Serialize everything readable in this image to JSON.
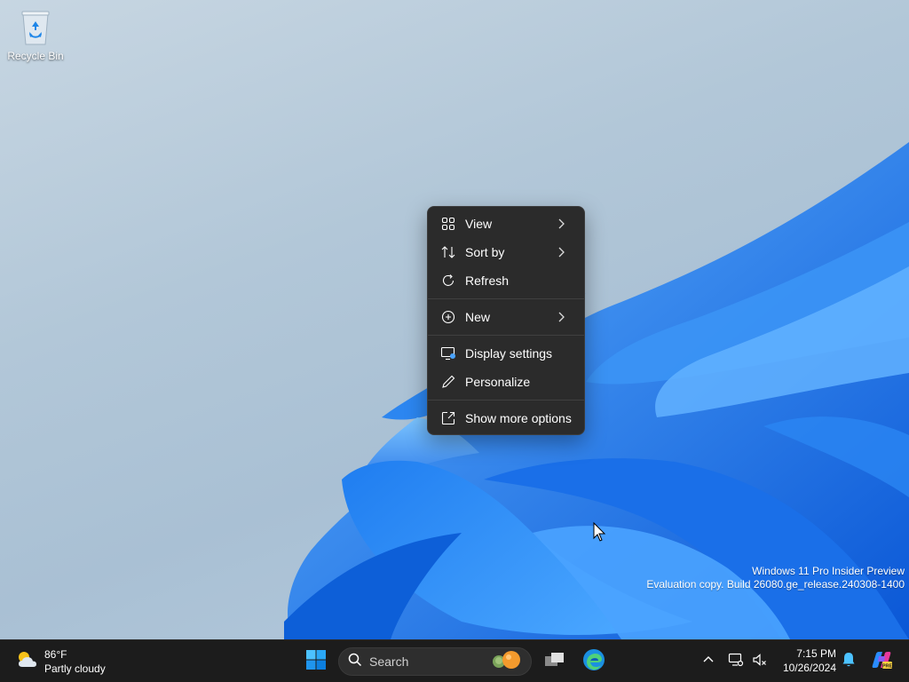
{
  "desktop": {
    "icons": [
      {
        "label": "Recycle Bin",
        "icon": "recycle-bin-icon"
      }
    ],
    "watermark": {
      "line1": "Windows 11 Pro Insider Preview",
      "line2": "Evaluation copy. Build 26080.ge_release.240308-1400"
    }
  },
  "context_menu": {
    "items": [
      {
        "label": "View",
        "icon": "grid-icon",
        "submenu": true
      },
      {
        "label": "Sort by",
        "icon": "sort-icon",
        "submenu": true
      },
      {
        "label": "Refresh",
        "icon": "refresh-icon",
        "submenu": false
      },
      {
        "label": "New",
        "icon": "plus-circle-icon",
        "submenu": true
      },
      {
        "label": "Display settings",
        "icon": "display-settings-icon",
        "submenu": false
      },
      {
        "label": "Personalize",
        "icon": "pen-icon",
        "submenu": false
      },
      {
        "label": "Show more options",
        "icon": "open-external-icon",
        "submenu": false
      }
    ]
  },
  "taskbar": {
    "weather": {
      "temp": "86°F",
      "condition": "Partly cloudy",
      "icon": "partly-cloudy-icon"
    },
    "search": {
      "placeholder": "Search"
    },
    "apps": [
      "windows-start-icon",
      "task-view-icon",
      "edge-icon"
    ],
    "tray": [
      "chevron-up-icon",
      "network-icon",
      "volume-muted-icon",
      "notification-bell-icon",
      "copilot-icon"
    ],
    "clock": {
      "time": "7:15 PM",
      "date": "10/26/2024"
    }
  },
  "colors": {
    "accent": "#0078d4",
    "menu_bg": "#2b2b2b",
    "taskbar_bg": "#1c1c1c"
  }
}
